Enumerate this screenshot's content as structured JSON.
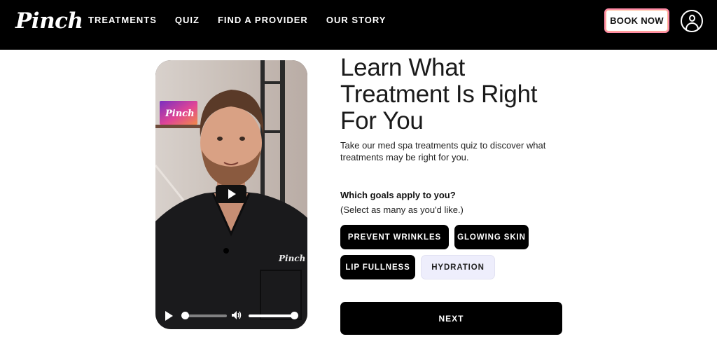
{
  "header": {
    "logo": "Pinch",
    "nav": [
      "TREATMENTS",
      "QUIZ",
      "FIND A PROVIDER",
      "OUR STORY"
    ],
    "book_label": "BOOK NOW",
    "account_icon": "user-circle-icon"
  },
  "video": {
    "sign_text": "Pinch",
    "shirt_logo": "Pinch",
    "play_icon": "play-icon",
    "volume_icon": "volume-icon",
    "progress": 0.0,
    "volume": 1.0
  },
  "quiz": {
    "headline_lines": [
      "Learn What",
      "Treatment Is Right",
      "For You"
    ],
    "intro": "Take our med spa treatments quiz to discover what treatments may be right for you.",
    "question": "Which goals apply to you?",
    "hint": "(Select as many as you'd like.)",
    "options": [
      {
        "label": "PREVENT WRINKLES",
        "selected": true
      },
      {
        "label": "GLOWING SKIN",
        "selected": true
      },
      {
        "label": "LIP FULLNESS",
        "selected": true
      },
      {
        "label": "HYDRATION",
        "selected": false
      }
    ],
    "next_label": "NEXT"
  },
  "colors": {
    "header_bg": "#000000",
    "chip_selected": "#000000",
    "chip_unselected": "#eeeefc",
    "book_border": "#ff8aa7"
  }
}
